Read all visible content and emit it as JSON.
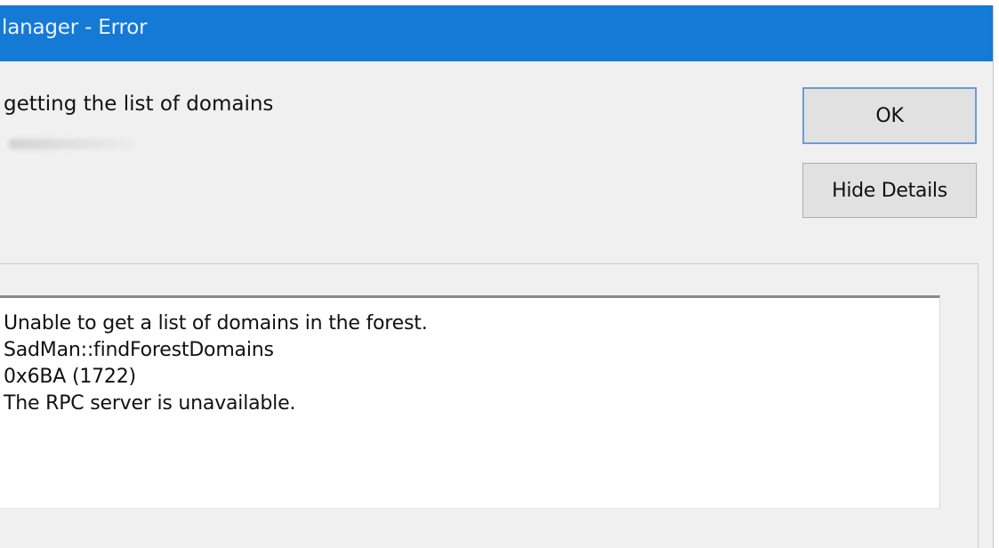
{
  "window": {
    "title": "lanager - Error"
  },
  "message": {
    "text": "getting the list of domains"
  },
  "buttons": {
    "ok_label": "OK",
    "hide_details_label": "Hide Details"
  },
  "details": {
    "lines": [
      "Unable to get a list of domains in the forest.",
      "SadMan::findForestDomains",
      "0x6BA (1722)",
      "The RPC server is unavailable."
    ]
  },
  "colors": {
    "titlebar": "#1579d6",
    "dialog_background": "#f0f0f0",
    "button_face": "#e1e1e1",
    "default_button_border": "#6e9bd6"
  }
}
